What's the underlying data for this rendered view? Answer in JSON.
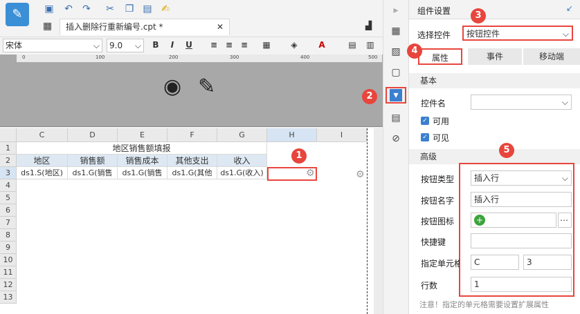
{
  "toolbar": {
    "file_tab": "插入删除行重新编号.cpt *",
    "close": "✕"
  },
  "format": {
    "font": "宋体",
    "size": "9.0",
    "bold": "B",
    "italic": "I",
    "underline": "U"
  },
  "ruler": {
    "marks": [
      "0",
      "100",
      "200",
      "300",
      "400",
      "500"
    ]
  },
  "grid": {
    "columns": [
      "C",
      "D",
      "E",
      "F",
      "G",
      "H",
      "I"
    ],
    "rows": [
      "1",
      "2",
      "3",
      "4",
      "5",
      "6",
      "7",
      "8",
      "9",
      "10",
      "11",
      "12",
      "13"
    ],
    "title": "地区销售额填报",
    "headers": [
      "地区",
      "销售额",
      "销售成本",
      "其他支出",
      "收入"
    ],
    "row3": [
      "ds1.S(地区)",
      "ds1.G(销售",
      "ds1.G(销售",
      "ds1.G(其他",
      "ds1.G(收入)"
    ]
  },
  "panel": {
    "title": "组件设置",
    "select_label": "选择控件",
    "select_value": "按钮控件",
    "tabs": [
      "属性",
      "事件",
      "移动端"
    ],
    "basic": "基本",
    "widget_name_label": "控件名",
    "enabled": "可用",
    "visible": "可见",
    "advanced": "高级",
    "button_type_label": "按钮类型",
    "button_type_value": "插入行",
    "button_name_label": "按钮名字",
    "button_name_value": "插入行",
    "button_icon_label": "按钮图标",
    "hotkey_label": "快捷键",
    "cell_label": "指定单元格",
    "cell_col": "C",
    "cell_row": "3",
    "rows_label": "行数",
    "rows_value": "1",
    "note": "注意！指定的单元格需要设置扩展属性"
  },
  "badges": [
    "1",
    "2",
    "3",
    "4",
    "5"
  ],
  "colors": {
    "accent": "#3b7fd0",
    "badge": "#e8453c"
  }
}
